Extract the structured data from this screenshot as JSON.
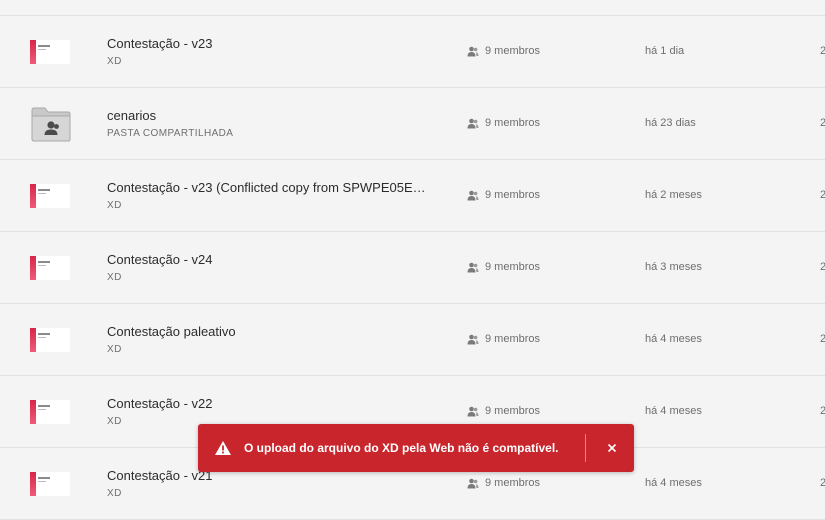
{
  "files": [
    {
      "name": "Contestação - v23",
      "type": "XD",
      "members": "9 membros",
      "modified": "há 1 dia",
      "kind": "xd"
    },
    {
      "name": "cenarios",
      "type": "PASTA COMPARTILHADA",
      "members": "9 membros",
      "modified": "há 23 dias",
      "kind": "folder"
    },
    {
      "name": "Contestação - v23 (Conflicted copy from SPWPE05E…",
      "type": "XD",
      "members": "9 membros",
      "modified": "há 2 meses",
      "kind": "xd"
    },
    {
      "name": "Contestação - v24",
      "type": "XD",
      "members": "9 membros",
      "modified": "há 3 meses",
      "kind": "xd"
    },
    {
      "name": "Contestação paleativo",
      "type": "XD",
      "members": "9 membros",
      "modified": "há 4 meses",
      "kind": "xd"
    },
    {
      "name": "Contestação - v22",
      "type": "XD",
      "members": "9 membros",
      "modified": "há 4 meses",
      "kind": "xd"
    },
    {
      "name": "Contestação - v21",
      "type": "XD",
      "members": "9 membros",
      "modified": "há 4 meses",
      "kind": "xd"
    }
  ],
  "edge_glyph": "2",
  "toast": {
    "message": "O upload do arquivo do XD pela Web não é compatível.",
    "close_label": "×",
    "icon": "warning-icon"
  },
  "colors": {
    "toast_bg": "#c9252c",
    "xd_accent": "#d7264a",
    "background": "#f4f4f4"
  }
}
